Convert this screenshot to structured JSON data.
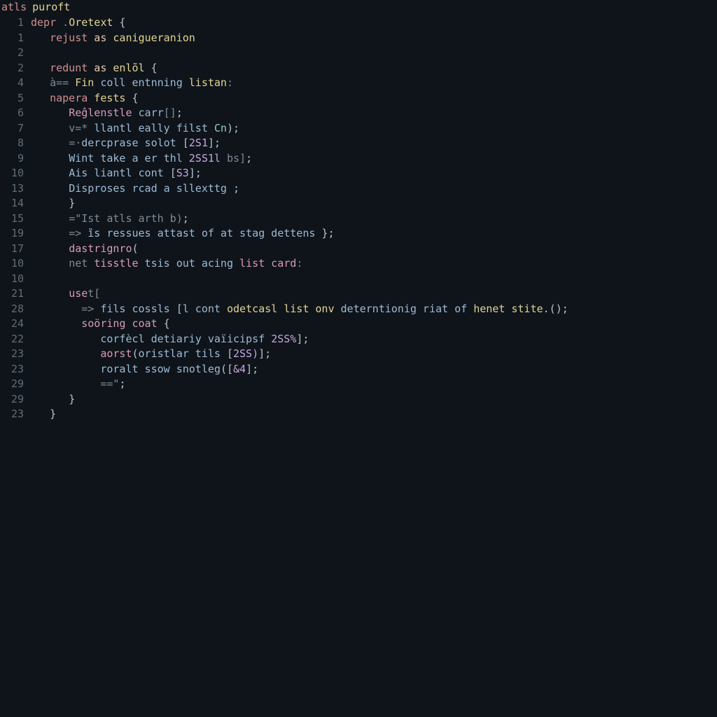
{
  "tab": {
    "left": "atls",
    "right": "puroft"
  },
  "lines": [
    {
      "num": "1",
      "tokens": [
        {
          "t": "depr",
          "c": "red"
        },
        {
          "t": " .",
          "c": "dim"
        },
        {
          "t": "Oretext",
          "c": "kw"
        },
        {
          "t": " {",
          "c": "pun"
        }
      ]
    },
    {
      "num": "1",
      "tokens": [
        {
          "t": "   ",
          "c": "pun"
        },
        {
          "t": "rejust",
          "c": "red"
        },
        {
          "t": " as ",
          "c": "pale"
        },
        {
          "t": "canigueranion",
          "c": "kw"
        }
      ]
    },
    {
      "num": "2",
      "tokens": [
        {
          "t": "",
          "c": "pun"
        }
      ]
    },
    {
      "num": "2",
      "tokens": [
        {
          "t": "   ",
          "c": "pun"
        },
        {
          "t": "redunt",
          "c": "red"
        },
        {
          "t": " as ",
          "c": "pale"
        },
        {
          "t": "enlõl",
          "c": "kw"
        },
        {
          "t": " {",
          "c": "pun"
        }
      ]
    },
    {
      "num": "4",
      "tokens": [
        {
          "t": "   ",
          "c": "pun"
        },
        {
          "t": "à== ",
          "c": "dim"
        },
        {
          "t": "Fin",
          "c": "kw"
        },
        {
          "t": " coll entnning ",
          "c": "id"
        },
        {
          "t": "listan",
          "c": "kw"
        },
        {
          "t": ":",
          "c": "dim"
        }
      ]
    },
    {
      "num": "5",
      "tokens": [
        {
          "t": "   ",
          "c": "pun"
        },
        {
          "t": "napera",
          "c": "red"
        },
        {
          "t": " fests",
          "c": "kw"
        },
        {
          "t": " {",
          "c": "pun"
        }
      ]
    },
    {
      "num": "6",
      "tokens": [
        {
          "t": "      ",
          "c": "pun"
        },
        {
          "t": "Reĝlenstle",
          "c": "pink"
        },
        {
          "t": " carr",
          "c": "id"
        },
        {
          "t": "[]",
          "c": "dim"
        },
        {
          "t": ";",
          "c": "pun"
        }
      ]
    },
    {
      "num": "7",
      "tokens": [
        {
          "t": "      ",
          "c": "pun"
        },
        {
          "t": "v=* ",
          "c": "dim"
        },
        {
          "t": "llantl eally filst ",
          "c": "id"
        },
        {
          "t": "Cn",
          "c": "cy"
        },
        {
          "t": ");",
          "c": "pun"
        }
      ]
    },
    {
      "num": "8",
      "tokens": [
        {
          "t": "      ",
          "c": "pun"
        },
        {
          "t": "=·",
          "c": "dim"
        },
        {
          "t": "dercprase solot ",
          "c": "id"
        },
        {
          "t": "[",
          "c": "pun"
        },
        {
          "t": "2S1",
          "c": "num"
        },
        {
          "t": "];",
          "c": "pun"
        }
      ]
    },
    {
      "num": "9",
      "tokens": [
        {
          "t": "      ",
          "c": "pun"
        },
        {
          "t": "Wint take a er thl ",
          "c": "id"
        },
        {
          "t": "2SS1l",
          "c": "num"
        },
        {
          "t": " bs]",
          "c": "dim"
        },
        {
          "t": ";",
          "c": "pun"
        }
      ]
    },
    {
      "num": "10",
      "tokens": [
        {
          "t": "      ",
          "c": "pun"
        },
        {
          "t": "Ais liantl cont ",
          "c": "id"
        },
        {
          "t": "[",
          "c": "pun"
        },
        {
          "t": "S3",
          "c": "num"
        },
        {
          "t": "];",
          "c": "pun"
        }
      ]
    },
    {
      "num": "13",
      "tokens": [
        {
          "t": "      ",
          "c": "pun"
        },
        {
          "t": "Disproses rcad a sllexttg ",
          "c": "id"
        },
        {
          "t": ";",
          "c": "pun"
        }
      ]
    },
    {
      "num": "14",
      "tokens": [
        {
          "t": "      ",
          "c": "pun"
        },
        {
          "t": "}",
          "c": "pun"
        }
      ]
    },
    {
      "num": "15",
      "tokens": [
        {
          "t": "      ",
          "c": "pun"
        },
        {
          "t": "=\"Ist atls arth b)",
          "c": "dim"
        },
        {
          "t": ";",
          "c": "pun"
        }
      ]
    },
    {
      "num": "19",
      "tokens": [
        {
          "t": "      ",
          "c": "pun"
        },
        {
          "t": "=> ",
          "c": "dim"
        },
        {
          "t": "ȉs ressues attast of at stag dettens ",
          "c": "id"
        },
        {
          "t": "};",
          "c": "pun"
        }
      ]
    },
    {
      "num": "17",
      "tokens": [
        {
          "t": "      ",
          "c": "pun"
        },
        {
          "t": "dastrignro",
          "c": "pink"
        },
        {
          "t": "(",
          "c": "pun"
        }
      ]
    },
    {
      "num": "10",
      "tokens": [
        {
          "t": "      ",
          "c": "pun"
        },
        {
          "t": "net ",
          "c": "dim"
        },
        {
          "t": "tisstle",
          "c": "pink"
        },
        {
          "t": " tsis out acing ",
          "c": "id"
        },
        {
          "t": "list card",
          "c": "pink"
        },
        {
          "t": ":",
          "c": "dim"
        }
      ]
    },
    {
      "num": "10",
      "tokens": [
        {
          "t": "",
          "c": "pun"
        }
      ]
    },
    {
      "num": "21",
      "tokens": [
        {
          "t": "      ",
          "c": "pun"
        },
        {
          "t": "use",
          "c": "pink"
        },
        {
          "t": "t[",
          "c": "dim"
        }
      ]
    },
    {
      "num": "28",
      "tokens": [
        {
          "t": "        ",
          "c": "pun"
        },
        {
          "t": "=> ",
          "c": "dim"
        },
        {
          "t": "fils cossls ",
          "c": "id"
        },
        {
          "t": "[",
          "c": "pun"
        },
        {
          "t": "l cont ",
          "c": "id"
        },
        {
          "t": "odetcasl list onv ",
          "c": "kw"
        },
        {
          "t": "deterntionig riat of ",
          "c": "id"
        },
        {
          "t": "henet stite",
          "c": "kw"
        },
        {
          "t": ".();",
          "c": "pun"
        }
      ]
    },
    {
      "num": "24",
      "tokens": [
        {
          "t": "        ",
          "c": "pun"
        },
        {
          "t": "soöring coat",
          "c": "pink"
        },
        {
          "t": " {",
          "c": "pun"
        }
      ]
    },
    {
      "num": "22",
      "tokens": [
        {
          "t": "           ",
          "c": "pun"
        },
        {
          "t": "corfècl detiariy vaïicipsf ",
          "c": "id"
        },
        {
          "t": "2SS%",
          "c": "num"
        },
        {
          "t": "];",
          "c": "pun"
        }
      ]
    },
    {
      "num": "23",
      "tokens": [
        {
          "t": "           ",
          "c": "pun"
        },
        {
          "t": "aorst",
          "c": "pink"
        },
        {
          "t": "(",
          "c": "pun"
        },
        {
          "t": "oristlar tils ",
          "c": "id"
        },
        {
          "t": "[",
          "c": "pun"
        },
        {
          "t": "2SS)",
          "c": "num"
        },
        {
          "t": "];",
          "c": "pun"
        }
      ]
    },
    {
      "num": "23",
      "tokens": [
        {
          "t": "           ",
          "c": "pun"
        },
        {
          "t": "roralt ssow snotleg",
          "c": "id"
        },
        {
          "t": "([",
          "c": "pun"
        },
        {
          "t": "&4",
          "c": "num"
        },
        {
          "t": "];",
          "c": "pun"
        }
      ]
    },
    {
      "num": "29",
      "tokens": [
        {
          "t": "           ",
          "c": "pun"
        },
        {
          "t": "==\"",
          "c": "dim"
        },
        {
          "t": ";",
          "c": "pun"
        }
      ]
    },
    {
      "num": "29",
      "tokens": [
        {
          "t": "      ",
          "c": "pun"
        },
        {
          "t": "}",
          "c": "pun"
        }
      ]
    },
    {
      "num": "23",
      "tokens": [
        {
          "t": "   ",
          "c": "pun"
        },
        {
          "t": "}",
          "c": "pun"
        }
      ]
    }
  ]
}
